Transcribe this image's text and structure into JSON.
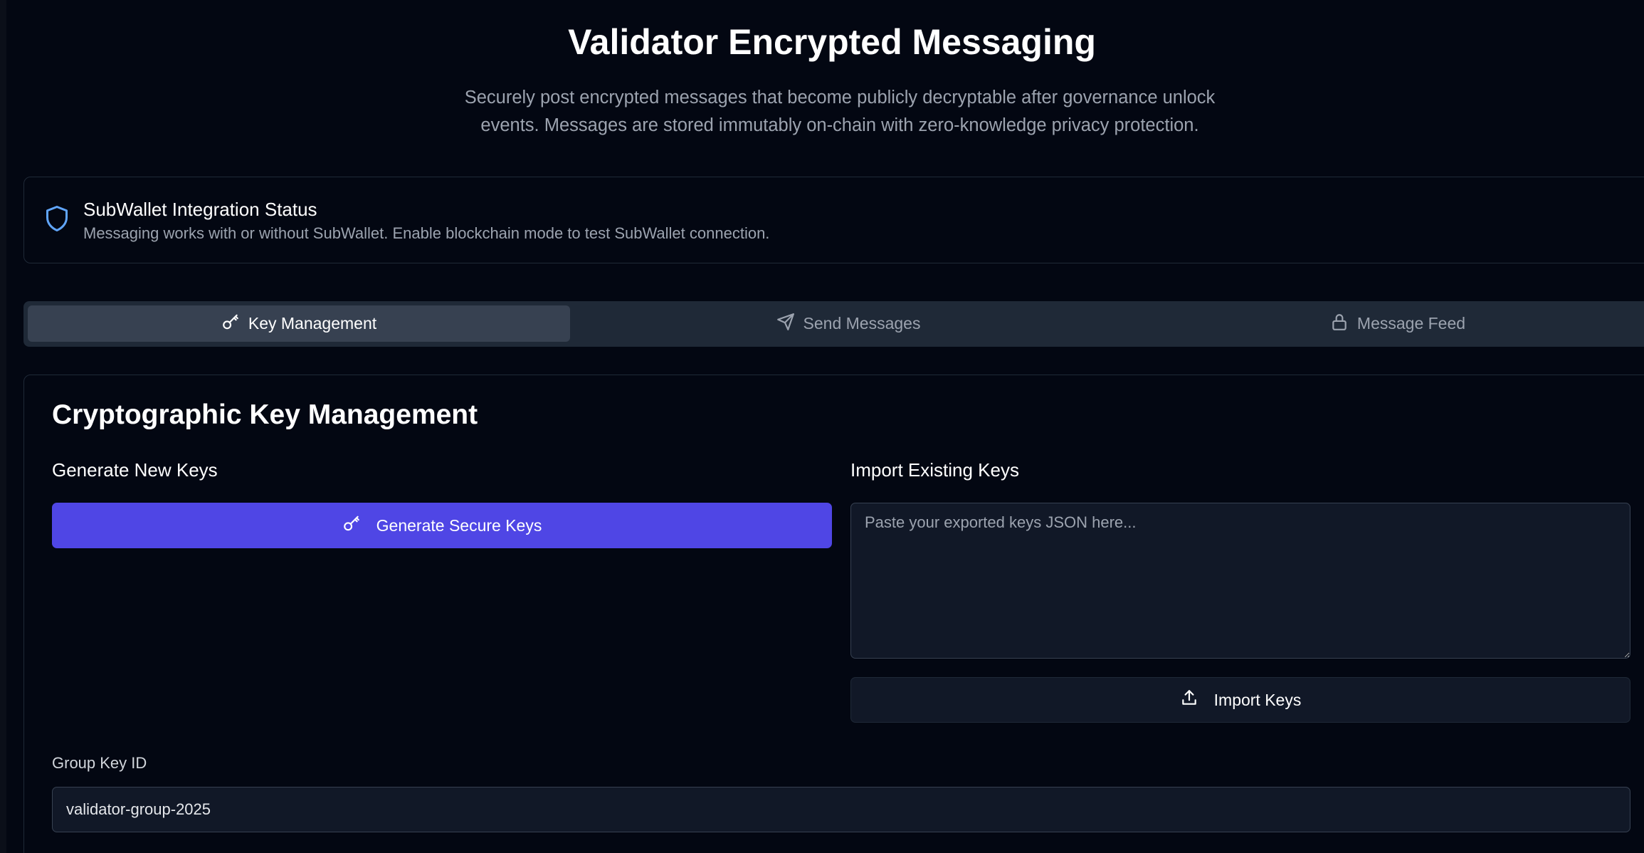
{
  "header": {
    "title": "Validator Encrypted Messaging",
    "subtitle": "Securely post encrypted messages that become publicly decryptable after governance unlock events. Messages are stored immutably on-chain with zero-knowledge privacy protection."
  },
  "status": {
    "icon": "shield-icon",
    "title": "SubWallet Integration Status",
    "description": "Messaging works with or without SubWallet. Enable blockchain mode to test SubWallet connection."
  },
  "tabs": [
    {
      "label": "Key Management",
      "icon": "key-icon",
      "active": true
    },
    {
      "label": "Send Messages",
      "icon": "send-icon",
      "active": false
    },
    {
      "label": "Message Feed",
      "icon": "lock-icon",
      "active": false
    }
  ],
  "key_management": {
    "title": "Cryptographic Key Management",
    "generate": {
      "label": "Generate New Keys",
      "button_label": "Generate Secure Keys"
    },
    "import": {
      "label": "Import Existing Keys",
      "placeholder": "Paste your exported keys JSON here...",
      "value": "",
      "button_label": "Import Keys"
    },
    "group_key": {
      "label": "Group Key ID",
      "value": "validator-group-2025"
    }
  },
  "colors": {
    "background": "#030712",
    "primary": "#4f46e5",
    "shield_accent": "#60a5fa",
    "muted_text": "#9ca3af"
  }
}
